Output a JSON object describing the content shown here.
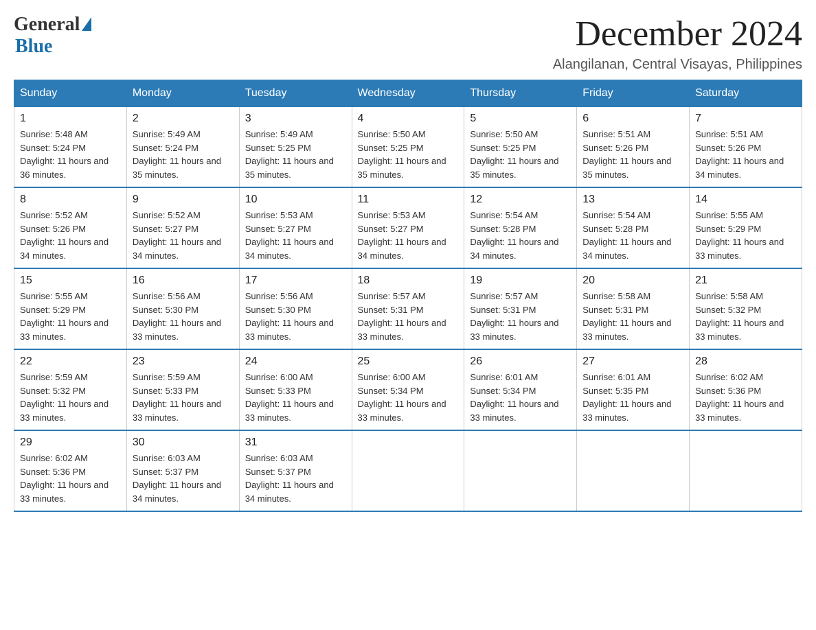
{
  "logo": {
    "general": "General",
    "blue": "Blue"
  },
  "title": "December 2024",
  "location": "Alangilanan, Central Visayas, Philippines",
  "days_of_week": [
    "Sunday",
    "Monday",
    "Tuesday",
    "Wednesday",
    "Thursday",
    "Friday",
    "Saturday"
  ],
  "weeks": [
    [
      {
        "day": "1",
        "info": "Sunrise: 5:48 AM\nSunset: 5:24 PM\nDaylight: 11 hours and 36 minutes."
      },
      {
        "day": "2",
        "info": "Sunrise: 5:49 AM\nSunset: 5:24 PM\nDaylight: 11 hours and 35 minutes."
      },
      {
        "day": "3",
        "info": "Sunrise: 5:49 AM\nSunset: 5:25 PM\nDaylight: 11 hours and 35 minutes."
      },
      {
        "day": "4",
        "info": "Sunrise: 5:50 AM\nSunset: 5:25 PM\nDaylight: 11 hours and 35 minutes."
      },
      {
        "day": "5",
        "info": "Sunrise: 5:50 AM\nSunset: 5:25 PM\nDaylight: 11 hours and 35 minutes."
      },
      {
        "day": "6",
        "info": "Sunrise: 5:51 AM\nSunset: 5:26 PM\nDaylight: 11 hours and 35 minutes."
      },
      {
        "day": "7",
        "info": "Sunrise: 5:51 AM\nSunset: 5:26 PM\nDaylight: 11 hours and 34 minutes."
      }
    ],
    [
      {
        "day": "8",
        "info": "Sunrise: 5:52 AM\nSunset: 5:26 PM\nDaylight: 11 hours and 34 minutes."
      },
      {
        "day": "9",
        "info": "Sunrise: 5:52 AM\nSunset: 5:27 PM\nDaylight: 11 hours and 34 minutes."
      },
      {
        "day": "10",
        "info": "Sunrise: 5:53 AM\nSunset: 5:27 PM\nDaylight: 11 hours and 34 minutes."
      },
      {
        "day": "11",
        "info": "Sunrise: 5:53 AM\nSunset: 5:27 PM\nDaylight: 11 hours and 34 minutes."
      },
      {
        "day": "12",
        "info": "Sunrise: 5:54 AM\nSunset: 5:28 PM\nDaylight: 11 hours and 34 minutes."
      },
      {
        "day": "13",
        "info": "Sunrise: 5:54 AM\nSunset: 5:28 PM\nDaylight: 11 hours and 34 minutes."
      },
      {
        "day": "14",
        "info": "Sunrise: 5:55 AM\nSunset: 5:29 PM\nDaylight: 11 hours and 33 minutes."
      }
    ],
    [
      {
        "day": "15",
        "info": "Sunrise: 5:55 AM\nSunset: 5:29 PM\nDaylight: 11 hours and 33 minutes."
      },
      {
        "day": "16",
        "info": "Sunrise: 5:56 AM\nSunset: 5:30 PM\nDaylight: 11 hours and 33 minutes."
      },
      {
        "day": "17",
        "info": "Sunrise: 5:56 AM\nSunset: 5:30 PM\nDaylight: 11 hours and 33 minutes."
      },
      {
        "day": "18",
        "info": "Sunrise: 5:57 AM\nSunset: 5:31 PM\nDaylight: 11 hours and 33 minutes."
      },
      {
        "day": "19",
        "info": "Sunrise: 5:57 AM\nSunset: 5:31 PM\nDaylight: 11 hours and 33 minutes."
      },
      {
        "day": "20",
        "info": "Sunrise: 5:58 AM\nSunset: 5:31 PM\nDaylight: 11 hours and 33 minutes."
      },
      {
        "day": "21",
        "info": "Sunrise: 5:58 AM\nSunset: 5:32 PM\nDaylight: 11 hours and 33 minutes."
      }
    ],
    [
      {
        "day": "22",
        "info": "Sunrise: 5:59 AM\nSunset: 5:32 PM\nDaylight: 11 hours and 33 minutes."
      },
      {
        "day": "23",
        "info": "Sunrise: 5:59 AM\nSunset: 5:33 PM\nDaylight: 11 hours and 33 minutes."
      },
      {
        "day": "24",
        "info": "Sunrise: 6:00 AM\nSunset: 5:33 PM\nDaylight: 11 hours and 33 minutes."
      },
      {
        "day": "25",
        "info": "Sunrise: 6:00 AM\nSunset: 5:34 PM\nDaylight: 11 hours and 33 minutes."
      },
      {
        "day": "26",
        "info": "Sunrise: 6:01 AM\nSunset: 5:34 PM\nDaylight: 11 hours and 33 minutes."
      },
      {
        "day": "27",
        "info": "Sunrise: 6:01 AM\nSunset: 5:35 PM\nDaylight: 11 hours and 33 minutes."
      },
      {
        "day": "28",
        "info": "Sunrise: 6:02 AM\nSunset: 5:36 PM\nDaylight: 11 hours and 33 minutes."
      }
    ],
    [
      {
        "day": "29",
        "info": "Sunrise: 6:02 AM\nSunset: 5:36 PM\nDaylight: 11 hours and 33 minutes."
      },
      {
        "day": "30",
        "info": "Sunrise: 6:03 AM\nSunset: 5:37 PM\nDaylight: 11 hours and 34 minutes."
      },
      {
        "day": "31",
        "info": "Sunrise: 6:03 AM\nSunset: 5:37 PM\nDaylight: 11 hours and 34 minutes."
      },
      {
        "day": "",
        "info": ""
      },
      {
        "day": "",
        "info": ""
      },
      {
        "day": "",
        "info": ""
      },
      {
        "day": "",
        "info": ""
      }
    ]
  ]
}
